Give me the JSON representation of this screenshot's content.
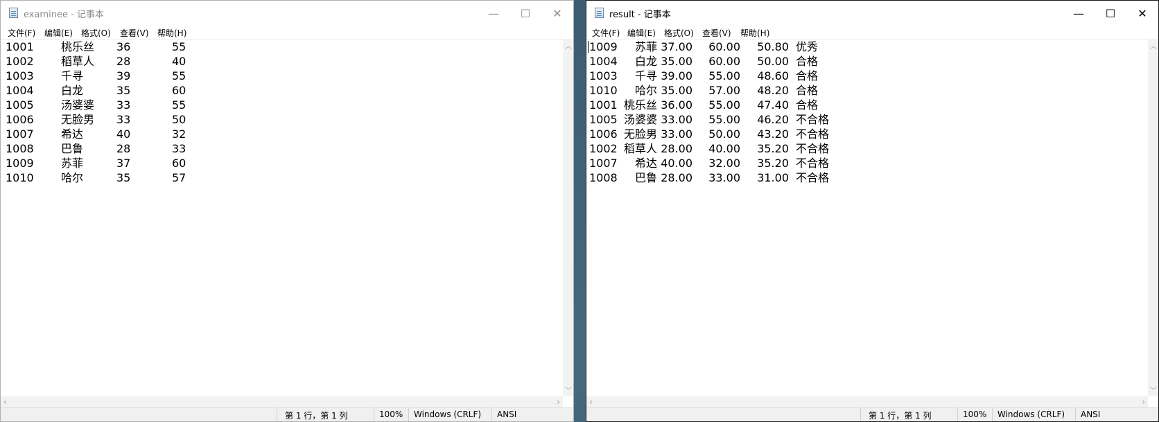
{
  "left_window": {
    "title": "examinee - 记事本",
    "menu": [
      "文件(F)",
      "编辑(E)",
      "格式(O)",
      "查看(V)",
      "帮助(H)"
    ],
    "rows": [
      [
        "1001",
        "桃乐丝",
        "36",
        "55"
      ],
      [
        "1002",
        "稻草人",
        "28",
        "40"
      ],
      [
        "1003",
        "千寻",
        "39",
        "55"
      ],
      [
        "1004",
        "白龙",
        "35",
        "60"
      ],
      [
        "1005",
        "汤婆婆",
        "33",
        "55"
      ],
      [
        "1006",
        "无脸男",
        "33",
        "50"
      ],
      [
        "1007",
        "希达",
        "40",
        "32"
      ],
      [
        "1008",
        "巴鲁",
        "28",
        "33"
      ],
      [
        "1009",
        "苏菲",
        "37",
        "60"
      ],
      [
        "1010",
        "哈尔",
        "35",
        "57"
      ]
    ],
    "status": {
      "position": "第 1 行，第 1 列",
      "zoom": "100%",
      "line_ending": "Windows (CRLF)",
      "encoding": "ANSI"
    }
  },
  "right_window": {
    "title": "result - 记事本",
    "menu": [
      "文件(F)",
      "编辑(E)",
      "格式(O)",
      "查看(V)",
      "帮助(H)"
    ],
    "rows": [
      [
        "1009",
        "苏菲",
        "37.00",
        "60.00",
        "50.80",
        "优秀"
      ],
      [
        "1004",
        "白龙",
        "35.00",
        "60.00",
        "50.00",
        "合格"
      ],
      [
        "1003",
        "千寻",
        "39.00",
        "55.00",
        "48.60",
        "合格"
      ],
      [
        "1010",
        "哈尔",
        "35.00",
        "57.00",
        "48.20",
        "合格"
      ],
      [
        "1001",
        "桃乐丝",
        "36.00",
        "55.00",
        "47.40",
        "合格"
      ],
      [
        "1005",
        "汤婆婆",
        "33.00",
        "55.00",
        "46.20",
        "不合格"
      ],
      [
        "1006",
        "无脸男",
        "33.00",
        "50.00",
        "43.20",
        "不合格"
      ],
      [
        "1002",
        "稻草人",
        "28.00",
        "40.00",
        "35.20",
        "不合格"
      ],
      [
        "1007",
        "希达",
        "40.00",
        "32.00",
        "35.20",
        "不合格"
      ],
      [
        "1008",
        "巴鲁",
        "28.00",
        "33.00",
        "31.00",
        "不合格"
      ]
    ],
    "status": {
      "position": "第 1 行，第 1 列",
      "zoom": "100%",
      "line_ending": "Windows (CRLF)",
      "encoding": "ANSI"
    }
  },
  "window_buttons": {
    "minimize": "—",
    "maximize": "☐",
    "close": "✕"
  },
  "icons": [
    "notepad-icon",
    "minimize-icon",
    "maximize-icon",
    "close-icon",
    "scroll-up-arrow-icon",
    "scroll-down-arrow-icon",
    "scroll-left-arrow-icon",
    "scroll-right-arrow-icon"
  ]
}
